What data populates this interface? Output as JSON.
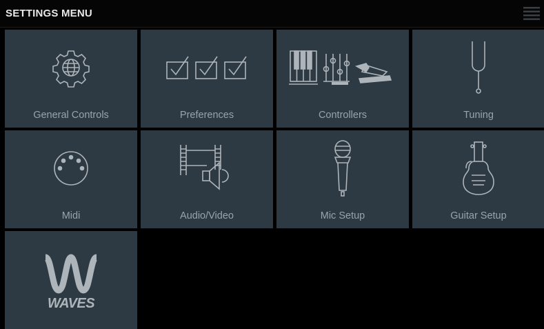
{
  "header": {
    "title": "SETTINGS MENU",
    "menu_icon": "list-icon"
  },
  "tiles": [
    {
      "label": "General Controls",
      "icon": "gear-globe-icon"
    },
    {
      "label": "Preferences",
      "icon": "checkboxes-icon"
    },
    {
      "label": "Controllers",
      "icon": "keys-sliders-pedal-icon"
    },
    {
      "label": "Tuning",
      "icon": "tuning-fork-icon"
    },
    {
      "label": "Midi",
      "icon": "midi-connector-icon"
    },
    {
      "label": "Audio/Video",
      "icon": "film-speaker-icon"
    },
    {
      "label": "Mic Setup",
      "icon": "microphone-icon"
    },
    {
      "label": "Guitar Setup",
      "icon": "guitar-icon"
    },
    {
      "label": "",
      "icon": "waves-logo-icon",
      "logo_text": "WAVES"
    }
  ],
  "colors": {
    "tile": "#2d3a43",
    "icon": "#aeb5ba",
    "label": "#9aa3aa",
    "background": "#000000"
  }
}
